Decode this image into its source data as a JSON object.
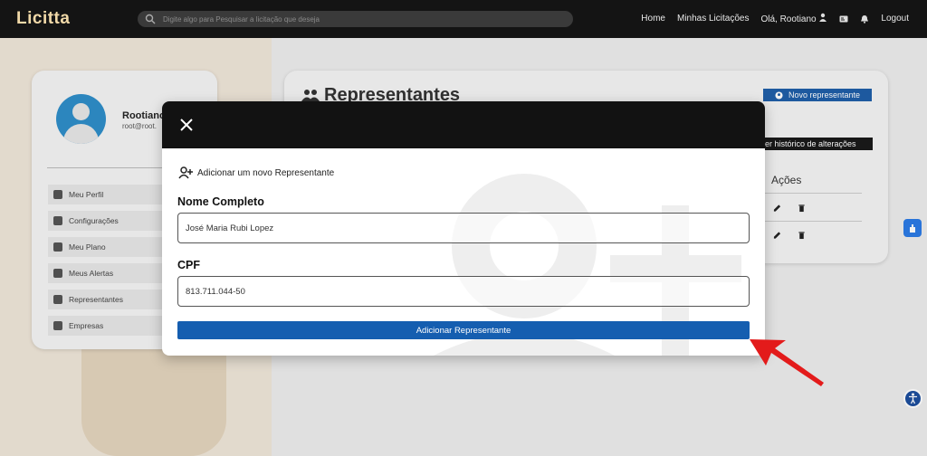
{
  "navbar": {
    "logo": "Licitta",
    "search_placeholder": "Digite algo para Pesquisar a licitação que deseja",
    "links": [
      "Home",
      "Minhas Licitações",
      "Olá, Rootiano"
    ],
    "logout": "Logout"
  },
  "profile": {
    "name": "Rootiano",
    "email": "root@root.",
    "menu": [
      {
        "label": "Meu Perfil",
        "icon": "user-icon"
      },
      {
        "label": "Configurações",
        "icon": "gear-icon"
      },
      {
        "label": "Meu Plano",
        "icon": "map-icon"
      },
      {
        "label": "Meus Alertas",
        "icon": "warning-icon"
      },
      {
        "label": "Representantes",
        "icon": "users-icon"
      },
      {
        "label": "Empresas",
        "icon": "building-icon"
      }
    ]
  },
  "page": {
    "title": "Representantes",
    "new_button": "Novo representante",
    "history_button": "er histórico de alterações",
    "actions_header": "Ações"
  },
  "modal": {
    "subtitle": "Adicionar um novo Representante",
    "name_label": "Nome Completo",
    "name_value": "José Maria Rubi Lopez",
    "cpf_label": "CPF",
    "cpf_value": "813.711.044-50",
    "submit_label": "Adicionar Representante"
  },
  "colors": {
    "navbar": "#141414",
    "primary": "#155eb0",
    "arrow": "#e31b1b"
  }
}
